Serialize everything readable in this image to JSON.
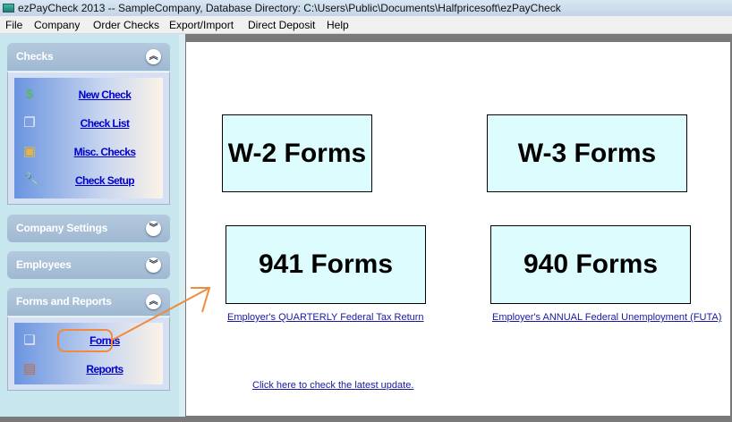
{
  "window": {
    "title": "ezPayCheck 2013 -- SampleCompany, Database Directory: C:\\Users\\Public\\Documents\\Halfpricesoft\\ezPayCheck"
  },
  "menu": [
    "File",
    "Company",
    "Order Checks",
    "Export/Import",
    "Direct Deposit",
    "Help"
  ],
  "sidebar": {
    "checks": {
      "title": "Checks",
      "items": [
        {
          "label": "New Check",
          "icon": "dollar-icon"
        },
        {
          "label": "Check List",
          "icon": "pages-icon"
        },
        {
          "label": "Misc. Checks",
          "icon": "document-badge-icon"
        },
        {
          "label": "Check Setup",
          "icon": "wrench-icon"
        }
      ]
    },
    "company_settings": {
      "title": "Company Settings"
    },
    "employees": {
      "title": "Employees"
    },
    "forms_reports": {
      "title": "Forms and Reports",
      "items": [
        {
          "label": "Forms",
          "icon": "windows-icon"
        },
        {
          "label": "Reports",
          "icon": "notebook-icon"
        }
      ]
    }
  },
  "main": {
    "w2": "W-2 Forms",
    "w3": "W-3 Forms",
    "f941": "941 Forms",
    "f940": "940 Forms",
    "f941_link": "Employer's QUARTERLY Federal Tax Return",
    "f940_link": "Employer's ANNUAL Federal Unemployment (FUTA)",
    "update_link": "Click here to check the latest update."
  },
  "colors": {
    "annotation": "#f08a3c",
    "button_bg": "#ddfcfd",
    "link": "#0000cc"
  }
}
